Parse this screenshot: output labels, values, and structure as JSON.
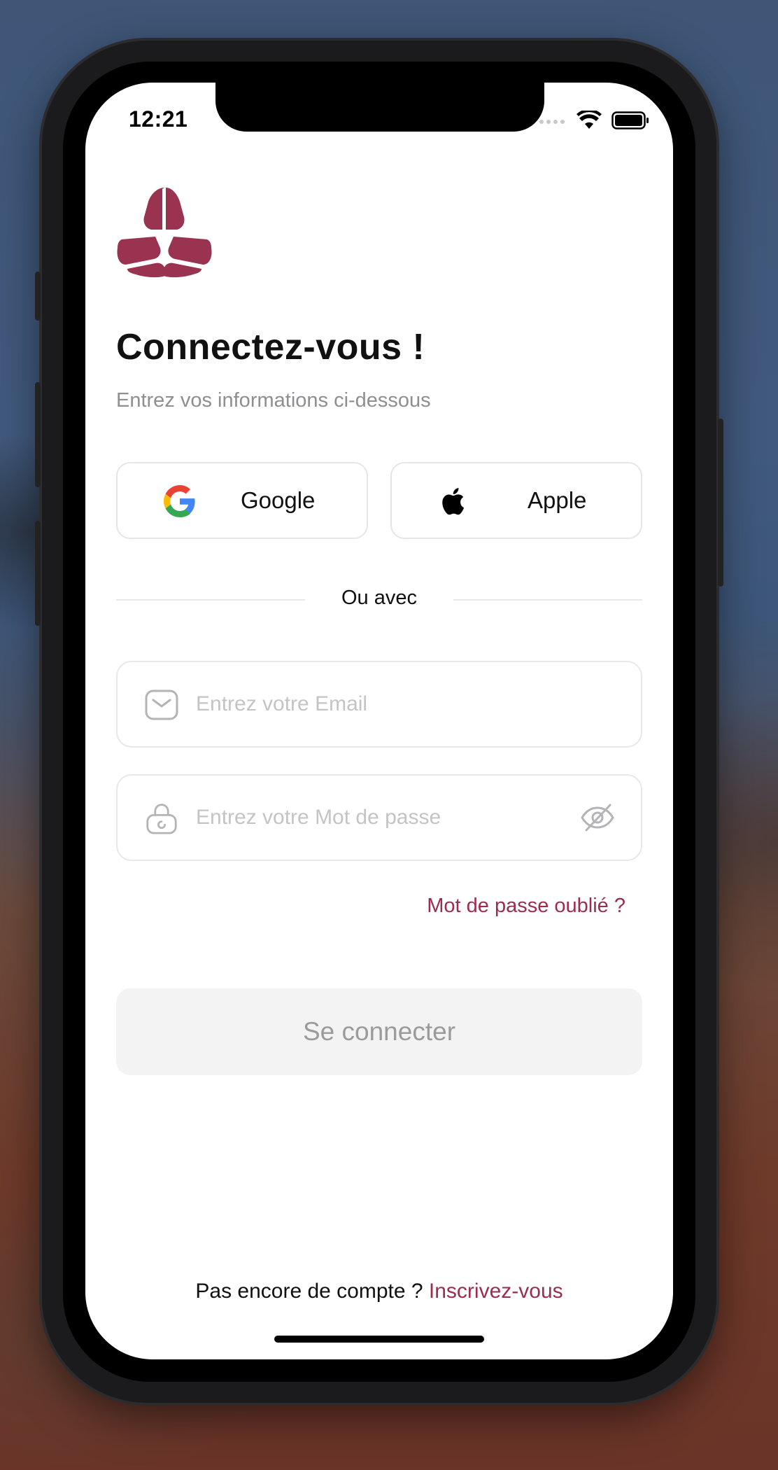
{
  "status_bar": {
    "time": "12:21",
    "icons": [
      "signal-icon",
      "wifi-icon",
      "battery-icon"
    ]
  },
  "brand": {
    "logo": "trefoil-logo",
    "color": "#9a2f4d"
  },
  "header": {
    "title": "Connectez-vous !",
    "subtitle": "Entrez vos informations ci-dessous"
  },
  "social": {
    "google_label": "Google",
    "apple_label": "Apple"
  },
  "divider": {
    "text": "Ou avec"
  },
  "form": {
    "email": {
      "placeholder": "Entrez votre Email",
      "value": ""
    },
    "password": {
      "placeholder": "Entrez votre Mot de passe",
      "value": ""
    },
    "forgot_label": "Mot de passe oublié ?",
    "submit_label": "Se connecter"
  },
  "footer": {
    "prompt": "Pas encore de compte ? ",
    "signup_label": "Inscrivez-vous"
  }
}
